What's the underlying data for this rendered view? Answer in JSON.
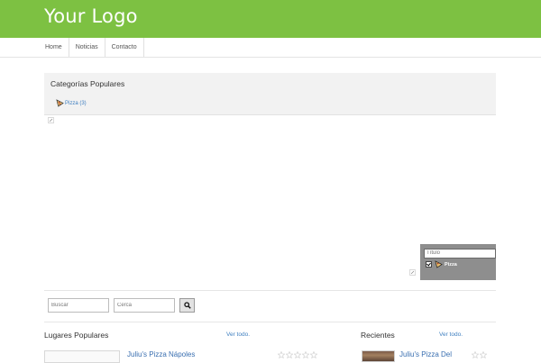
{
  "header": {
    "logo": "Your Logo",
    "bg_color": "#7dc142"
  },
  "nav": {
    "items": [
      {
        "label": "Home"
      },
      {
        "label": "Noticias"
      },
      {
        "label": "Contacto"
      }
    ]
  },
  "categories_box": {
    "title": "Categorías Populares",
    "items": [
      {
        "label": "Pizza (3)",
        "icon": "pizza-icon"
      }
    ]
  },
  "map": {
    "title_placeholder": "Título",
    "categories": [
      {
        "label": "Pizza",
        "checked": true,
        "icon": "pizza-icon"
      }
    ]
  },
  "search": {
    "query_placeholder": "Buscar",
    "near_placeholder": "Cerca",
    "button_icon": "magnifier-icon"
  },
  "popular": {
    "title": "Lugares Populares",
    "view_all": "Ver todo.",
    "first_item": "Juliu's Pizza Nápoles"
  },
  "recent": {
    "title": "Recientes",
    "view_all": "Ver todo.",
    "first_item": "Juliu's Pizza Del"
  },
  "colors": {
    "link": "#3f7fc0",
    "accent": "#7dc142",
    "panel": "#8e8e8e"
  }
}
